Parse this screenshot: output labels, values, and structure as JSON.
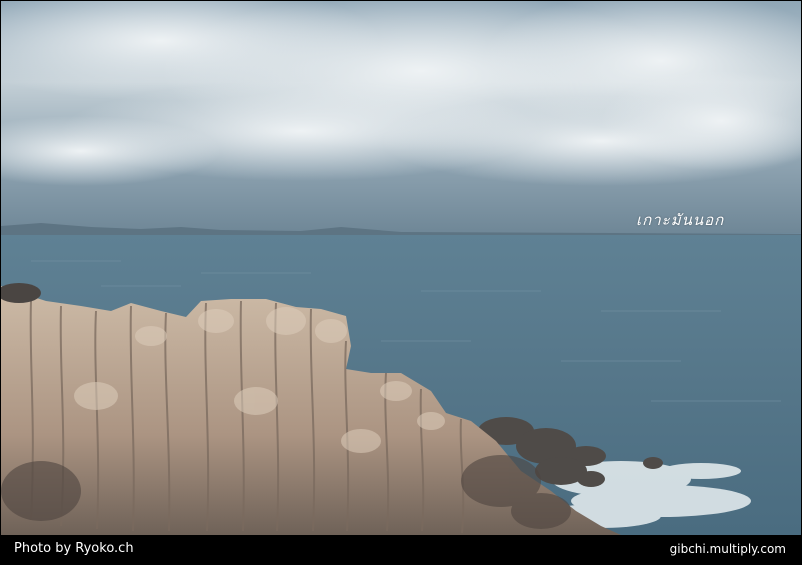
{
  "photo": {
    "caption": "เกาะมันนอก",
    "colors": {
      "sky_top": "#9fb2bf",
      "sky_mid": "#c9d4da",
      "horizon": "#6f8797",
      "sea": "#56788c",
      "sea_deep": "#4a6c80",
      "rock_light": "#c8b7a4",
      "rock_mid": "#a58e7c",
      "rock_dark": "#5a5450",
      "foam": "#e9f0f2"
    }
  },
  "footer": {
    "credit_left": "Photo by Ryoko.ch",
    "credit_right": "gibchi.multiply.com"
  }
}
